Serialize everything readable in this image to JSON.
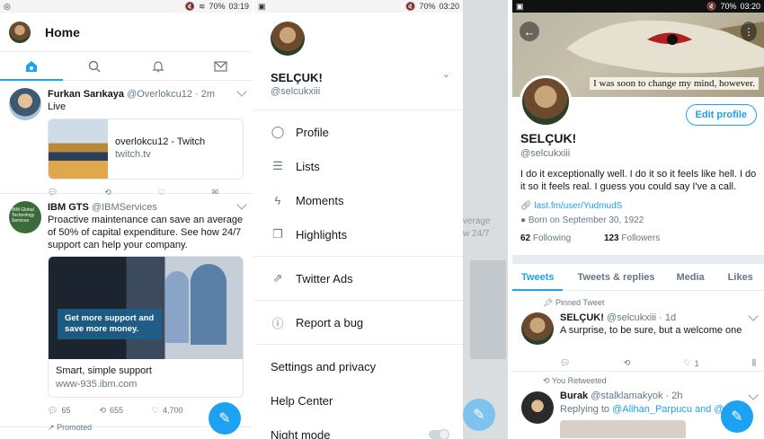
{
  "panel1": {
    "status": {
      "battery": "70%",
      "time": "03:19"
    },
    "header": {
      "title": "Home"
    },
    "tweets": [
      {
        "name": "Furkan Sarıkaya",
        "handle": "@Overlokcu12 · 2m",
        "text": "Live",
        "card": {
          "title": "overlokcu12 - Twitch",
          "domain": "twitch.tv"
        }
      },
      {
        "name": "IBM GTS",
        "handle": "@IBMServices",
        "text": "Proactive maintenance can save an average of 50% of capital expenditure. See how 24/7 support can help your company.",
        "avatar_text": "IBM Global Technology Services",
        "image_caption": "Get more support and save more money.",
        "card": {
          "title": "Smart, simple support",
          "domain": "www-935.ibm.com"
        },
        "counts": {
          "reply": "65",
          "retweet": "655",
          "like": "4,700"
        },
        "promoted": "Promoted"
      }
    ]
  },
  "panel2": {
    "status": {
      "battery": "70%",
      "time": "03:20"
    },
    "user": {
      "name": "SELÇUK!",
      "handle": "@selcukxiii"
    },
    "menu": [
      {
        "label": "Profile",
        "icon": "person-icon"
      },
      {
        "label": "Lists",
        "icon": "list-icon"
      },
      {
        "label": "Moments",
        "icon": "lightning-icon"
      },
      {
        "label": "Highlights",
        "icon": "highlights-icon"
      }
    ],
    "ads": {
      "label": "Twitter Ads",
      "icon": "external-icon"
    },
    "bug": {
      "label": "Report a bug",
      "icon": "info-icon"
    },
    "settings": [
      "Settings and privacy",
      "Help Center",
      "Night mode"
    ],
    "behind_text": {
      "line1": "verage",
      "line2": "w 24/7"
    }
  },
  "panel3": {
    "status": {
      "battery": "70%",
      "time": "03:20"
    },
    "banner_quote": "I was soon to change my mind, however.",
    "edit_button": "Edit profile",
    "name": "SELÇUK!",
    "handle": "@selcukxiii",
    "bio": "I do it exceptionally well. I do it so it feels like hell. I do it so it feels real. I guess you could say I've a call.",
    "link": "last.fm/user/YudmudS",
    "born": "Born on September 30, 1922",
    "following_count": "62",
    "following_label": "Following",
    "followers_count": "123",
    "followers_label": "Followers",
    "tabs": [
      "Tweets",
      "Tweets & replies",
      "Media",
      "Likes"
    ],
    "pinned": {
      "label": "Pinned Tweet",
      "name": "SELÇUK!",
      "handle": "@selcukxiii · 1d",
      "text": "A surprise, to be sure, but a welcome one",
      "likes": "1"
    },
    "retweet": {
      "label": "You Retweeted",
      "name": "Burak",
      "handle": "@stalklamakyok · 2h",
      "replying": "Replying to",
      "mentions": "@Alihan_Parpucu and @s"
    }
  },
  "colors": {
    "accent": "#1da1f2",
    "text": "#14171a",
    "muted": "#657786"
  }
}
